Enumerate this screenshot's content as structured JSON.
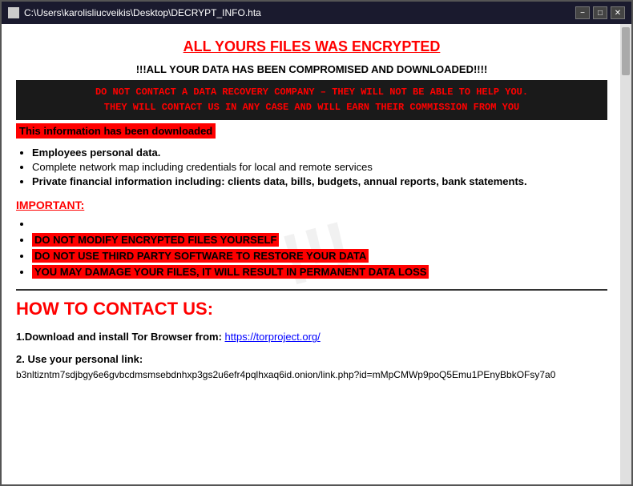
{
  "window": {
    "title": "C:\\Users\\karolisliucveikis\\Desktop\\DECRYPT_INFO.hta",
    "minimize": "−",
    "maximize": "□",
    "close": "✕"
  },
  "watermark": "!!!",
  "content": {
    "main_title": "ALL YOURS FILES WAS ENCRYPTED",
    "subtitle": "!!!ALL YOUR DATA HAS BEEN COMPROMISED AND DOWNLOADED!!!!",
    "red_block_line1": "DO NOT CONTACT A DATA RECOVERY COMPANY – THEY WILL NOT BE ABLE TO HELP YOU.",
    "red_block_line2": "THEY WILL CONTACT US IN ANY CASE AND WILL EARN THEIR COMMISSION FROM YOU",
    "downloaded_notice": "This information has been downloaded",
    "data_items": [
      "Employees personal data.",
      "Complete network map including credentials for local and remote services",
      "Private financial information including: clients data, bills, budgets, annual reports, bank statements."
    ],
    "important_label": "IMPORTANT:",
    "warning_items": [
      "",
      "DO NOT MODIFY ENCRYPTED FILES YOURSELF",
      "DO NOT USE THIRD PARTY SOFTWARE TO RESTORE YOUR DATA",
      "YOU MAY DAMAGE YOUR FILES, IT WILL RESULT IN PERMANENT DATA LOSS"
    ],
    "contact_title": "HOW TO CONTACT US:",
    "step1_label": "1.Download and install Tor Browser from:",
    "step1_link_text": "https://torproject.org/",
    "step1_link_href": "https://torproject.org/",
    "step2_label": "2. Use your personal link:",
    "personal_link": "b3nltizntm7sdjbgy6e6gvbcdmsmsebdnhxp3gs2u6efr4pqlhxaq6id.onion/link.php?id=mMpCMWp9poQ5Emu1PEnyBbkOFsy7a0"
  }
}
